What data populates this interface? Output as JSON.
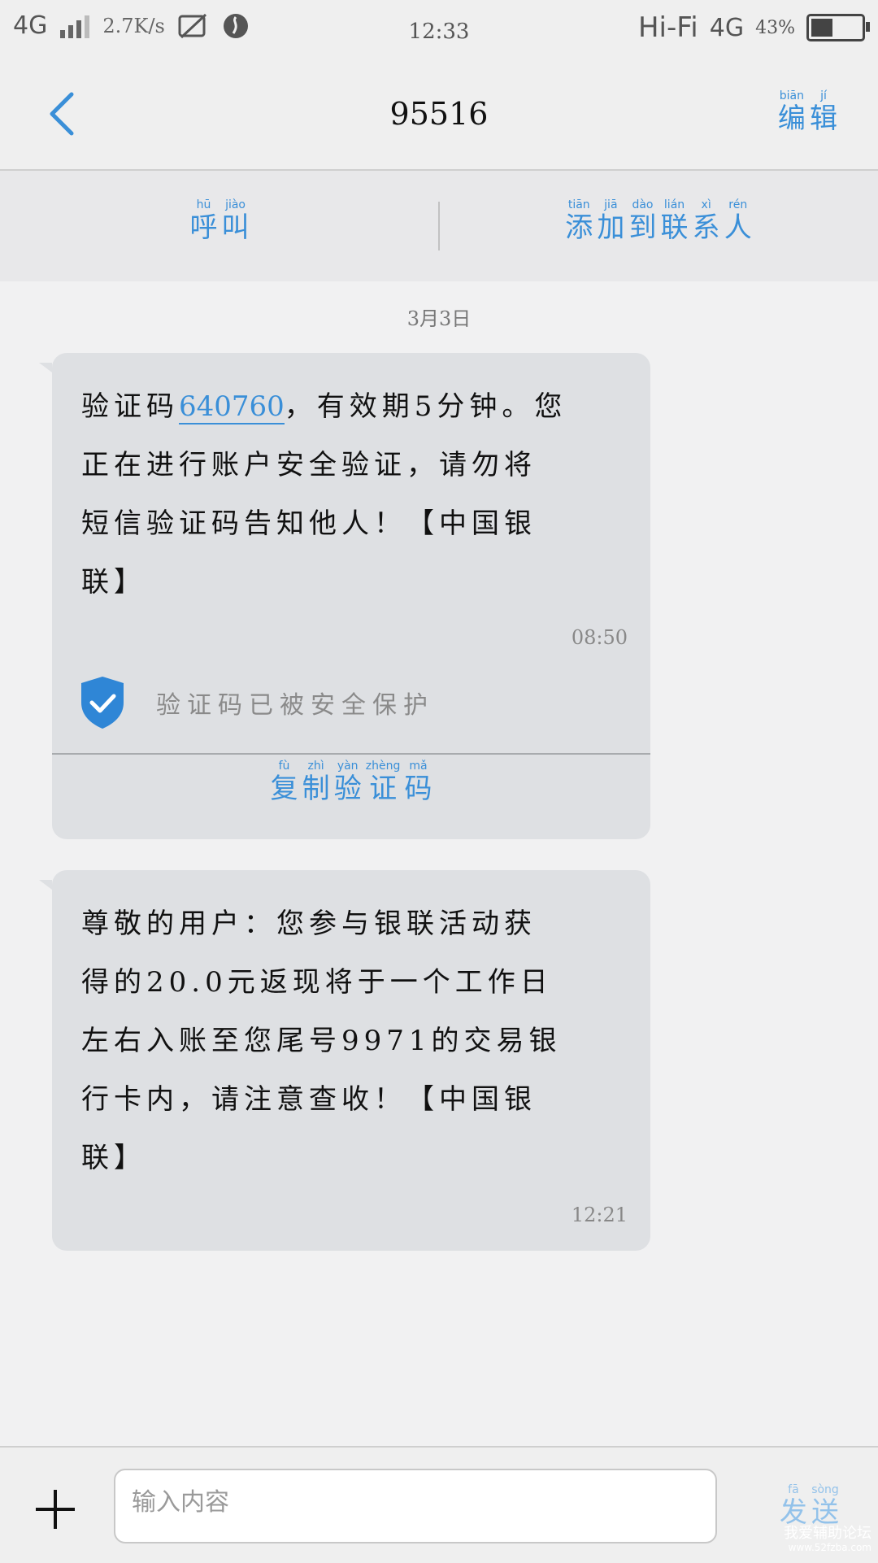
{
  "statusbar": {
    "network_left": "4G",
    "speed": "2.7K/s",
    "time": "12:33",
    "hifi": "Hi-Fi",
    "network_right": "4G",
    "battery": "43%",
    "battery_level_pct": 43
  },
  "header": {
    "title": "95516",
    "edit_chars": [
      "编",
      "辑"
    ],
    "edit_pinyin": [
      "biān",
      "jí"
    ]
  },
  "actions": {
    "call_chars": [
      "呼",
      "叫"
    ],
    "call_pinyin": [
      "hū",
      "jiào"
    ],
    "add_chars": [
      "添",
      "加",
      "到",
      "联",
      "系",
      "人"
    ],
    "add_pinyin": [
      "tiān",
      "jiā",
      "dào",
      "lián",
      "xì",
      "rén"
    ]
  },
  "date": "3月3日",
  "message1": {
    "code": "640760",
    "lines": [
      "验证码",
      "，有效期5分钟。您",
      "正在进行账户安全验证，请勿将",
      "短信验证码告知他人！【中国银",
      "联】"
    ],
    "time": "08:50",
    "protect_text": "验证码已被安全保护",
    "copy_chars": [
      "复",
      "制",
      "验",
      "证",
      "码"
    ],
    "copy_pinyin": [
      "fù",
      "zhì",
      "yàn",
      "zhèng",
      "mǎ"
    ]
  },
  "message2": {
    "lines": [
      "尊敬的用户：您参与银联活动获",
      "得的20.0元返现将于一个工作日",
      "左右入账至您尾号9971的交易银",
      "行卡内，请注意查收！【中国银",
      "联】"
    ],
    "time": "12:21"
  },
  "composer": {
    "placeholder": "输入内容",
    "send_chars": [
      "发",
      "送"
    ],
    "send_pinyin": [
      "fā",
      "sòng"
    ]
  },
  "watermark": {
    "line1": "我爱辅助论坛",
    "line2": "www.52fzba.com"
  },
  "colors": {
    "accent": "#3a8fd8",
    "bubble": "#dee0e3",
    "background": "#f1f1f2"
  }
}
